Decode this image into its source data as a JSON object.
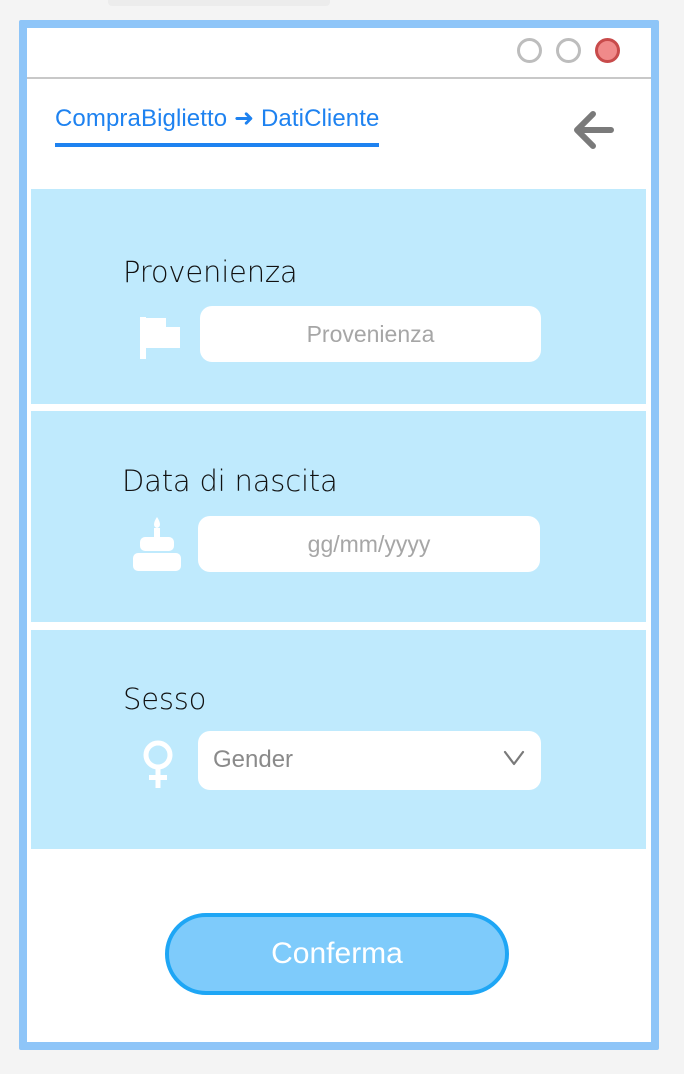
{
  "window": {
    "controls": [
      "minimize",
      "maximize",
      "close"
    ],
    "colors": {
      "frame": "#8ec5f8",
      "close": "#f08a8a",
      "section_bg": "#bfeafd",
      "accent": "#1e82f0",
      "button_fill": "#7ecbfb",
      "button_border": "#1ea6f5"
    }
  },
  "header": {
    "breadcrumb": "CompraBiglietto ➜ DatiCliente",
    "back_icon": "arrow-left-icon"
  },
  "form": {
    "provenienza": {
      "label": "Provenienza",
      "placeholder": "Provenienza",
      "value": "",
      "icon": "flag-icon"
    },
    "data_nascita": {
      "label": "Data di nascita",
      "placeholder": "gg/mm/yyyy",
      "value": "",
      "icon": "cake-icon"
    },
    "sesso": {
      "label": "Sesso",
      "selected": "Gender",
      "icon": "female-icon",
      "dropdown_icon": "chevron-down-icon"
    }
  },
  "actions": {
    "confirm_label": "Conferma"
  }
}
